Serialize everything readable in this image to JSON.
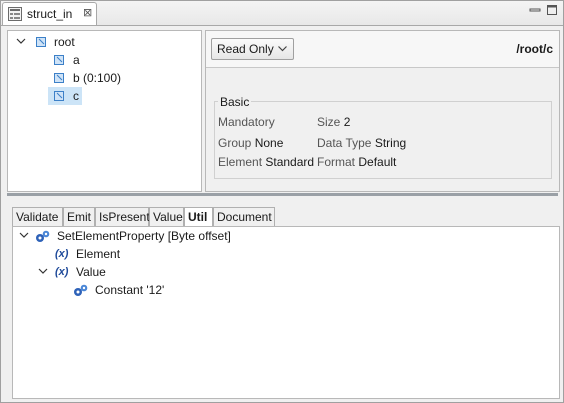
{
  "editor_tab": {
    "title": "struct_in",
    "close": "⊠"
  },
  "window_controls": [
    "minimize-icon",
    "maximize-icon"
  ],
  "tree": {
    "root": {
      "label": "root",
      "icon": "element-icon",
      "expanded": true
    },
    "children": [
      {
        "label": "a"
      },
      {
        "label": "b (0:100)"
      },
      {
        "label": "c",
        "selected": true
      }
    ]
  },
  "props": {
    "mode": "Read Only",
    "path": "/root/c",
    "group_title": "Basic",
    "mandatory_label": "Mandatory",
    "size_label": "Size",
    "size_value": "2",
    "group_label": "Group",
    "group_value": "None",
    "datatype_label": "Data Type",
    "datatype_value": "String",
    "element_label": "Element",
    "element_value": "Standard",
    "format_label": "Format",
    "format_value": "Default"
  },
  "bottom_tabs": [
    "Validate",
    "Emit",
    "IsPresent",
    "Value",
    "Util",
    "Document"
  ],
  "active_tab": "Util",
  "operations": {
    "root": "SetElementProperty [Byte offset]",
    "element": "Element",
    "value": "Value",
    "constant": "Constant '12'",
    "var_glyph": "(x)"
  },
  "colors": {
    "selection": "#cce4f7",
    "splitter": "#9aa0a6",
    "accent": "#3c80c8"
  }
}
